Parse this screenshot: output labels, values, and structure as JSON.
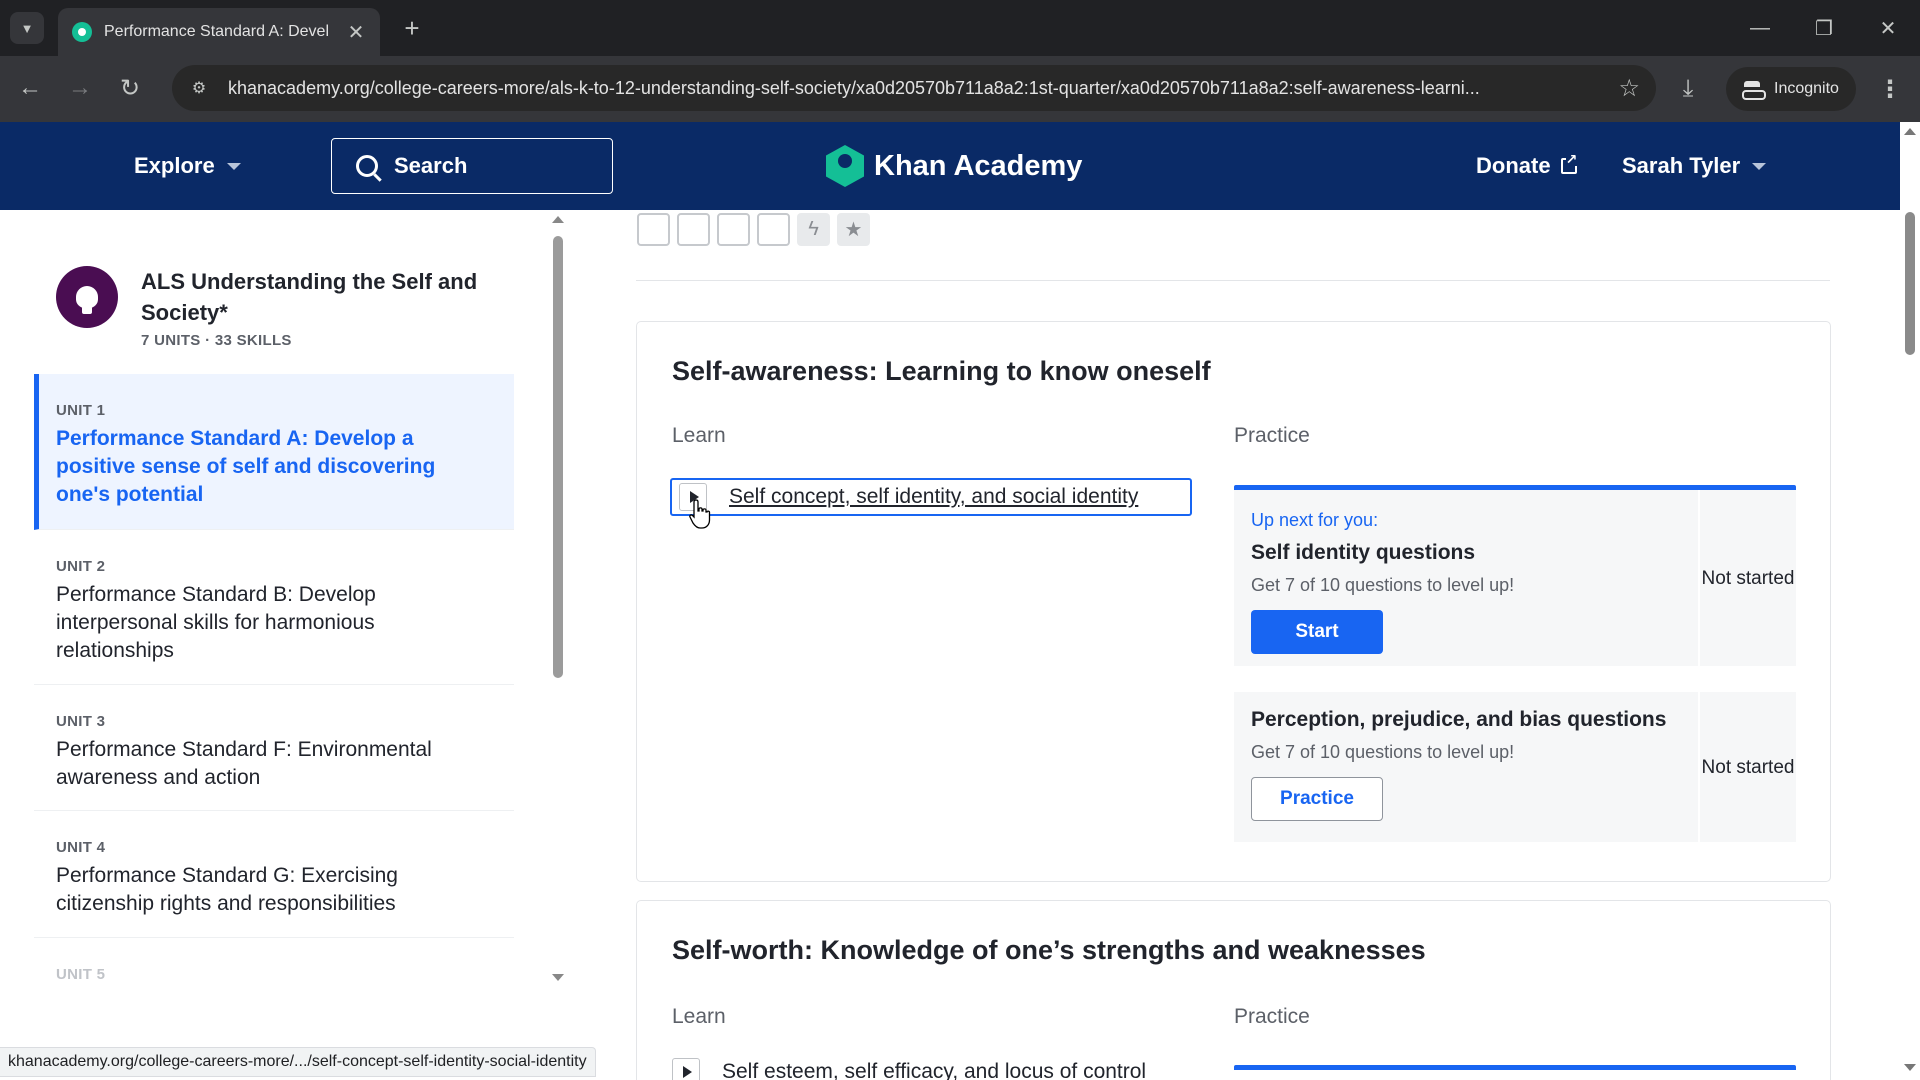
{
  "browser": {
    "tab_title": "Performance Standard A: Devel",
    "url": "khanacademy.org/college-careers-more/als-k-to-12-understanding-self-society/xa0d20570b711a8a2:1st-quarter/xa0d20570b711a8a2:self-awareness-learni...",
    "incognito_label": "Incognito",
    "status_url": "khanacademy.org/college-careers-more/.../self-concept-self-identity-social-identity"
  },
  "header": {
    "explore_label": "Explore",
    "search_label": "Search",
    "logo_text": "Khan Academy",
    "donate_label": "Donate",
    "user_name": "Sarah Tyler",
    "bg_color": "#0a2a66",
    "logo_color": "#14bf96"
  },
  "sidebar": {
    "course_title": "ALS Understanding the Self and Society*",
    "course_meta": "7 UNITS · 33 SKILLS",
    "units": [
      {
        "label": "UNIT 1",
        "title": "Performance Standard A: Develop a positive sense of self and discovering one's potential"
      },
      {
        "label": "UNIT 2",
        "title": "Performance Standard B: Develop interpersonal skills for harmonious relationships"
      },
      {
        "label": "UNIT 3",
        "title": "Performance Standard F: Environmental awareness and action"
      },
      {
        "label": "UNIT 4",
        "title": "Performance Standard G: Exercising citizenship rights and responsibilities"
      },
      {
        "label": "UNIT 5",
        "title": ""
      }
    ]
  },
  "progress_icons": [
    "lightning-icon",
    "star-icon"
  ],
  "lessons": [
    {
      "title": "Self-awareness: Learning to know oneself",
      "learn_label": "Learn",
      "practice_label": "Practice",
      "learn_item": "Self concept, self identity, and social identity",
      "practice": [
        {
          "up_next": "Up next for you:",
          "title": "Self identity questions",
          "subtitle": "Get 7 of 10 questions to level up!",
          "button": "Start",
          "status": "Not started"
        },
        {
          "title": "Perception, prejudice, and bias questions",
          "subtitle": "Get 7 of 10 questions to level up!",
          "button": "Practice",
          "status": "Not started"
        }
      ]
    },
    {
      "title": "Self-worth: Knowledge of one’s strengths and weaknesses",
      "learn_label": "Learn",
      "practice_label": "Practice",
      "learn_item": "Self esteem, self efficacy, and locus of control"
    }
  ],
  "accent_color": "#1865f2"
}
